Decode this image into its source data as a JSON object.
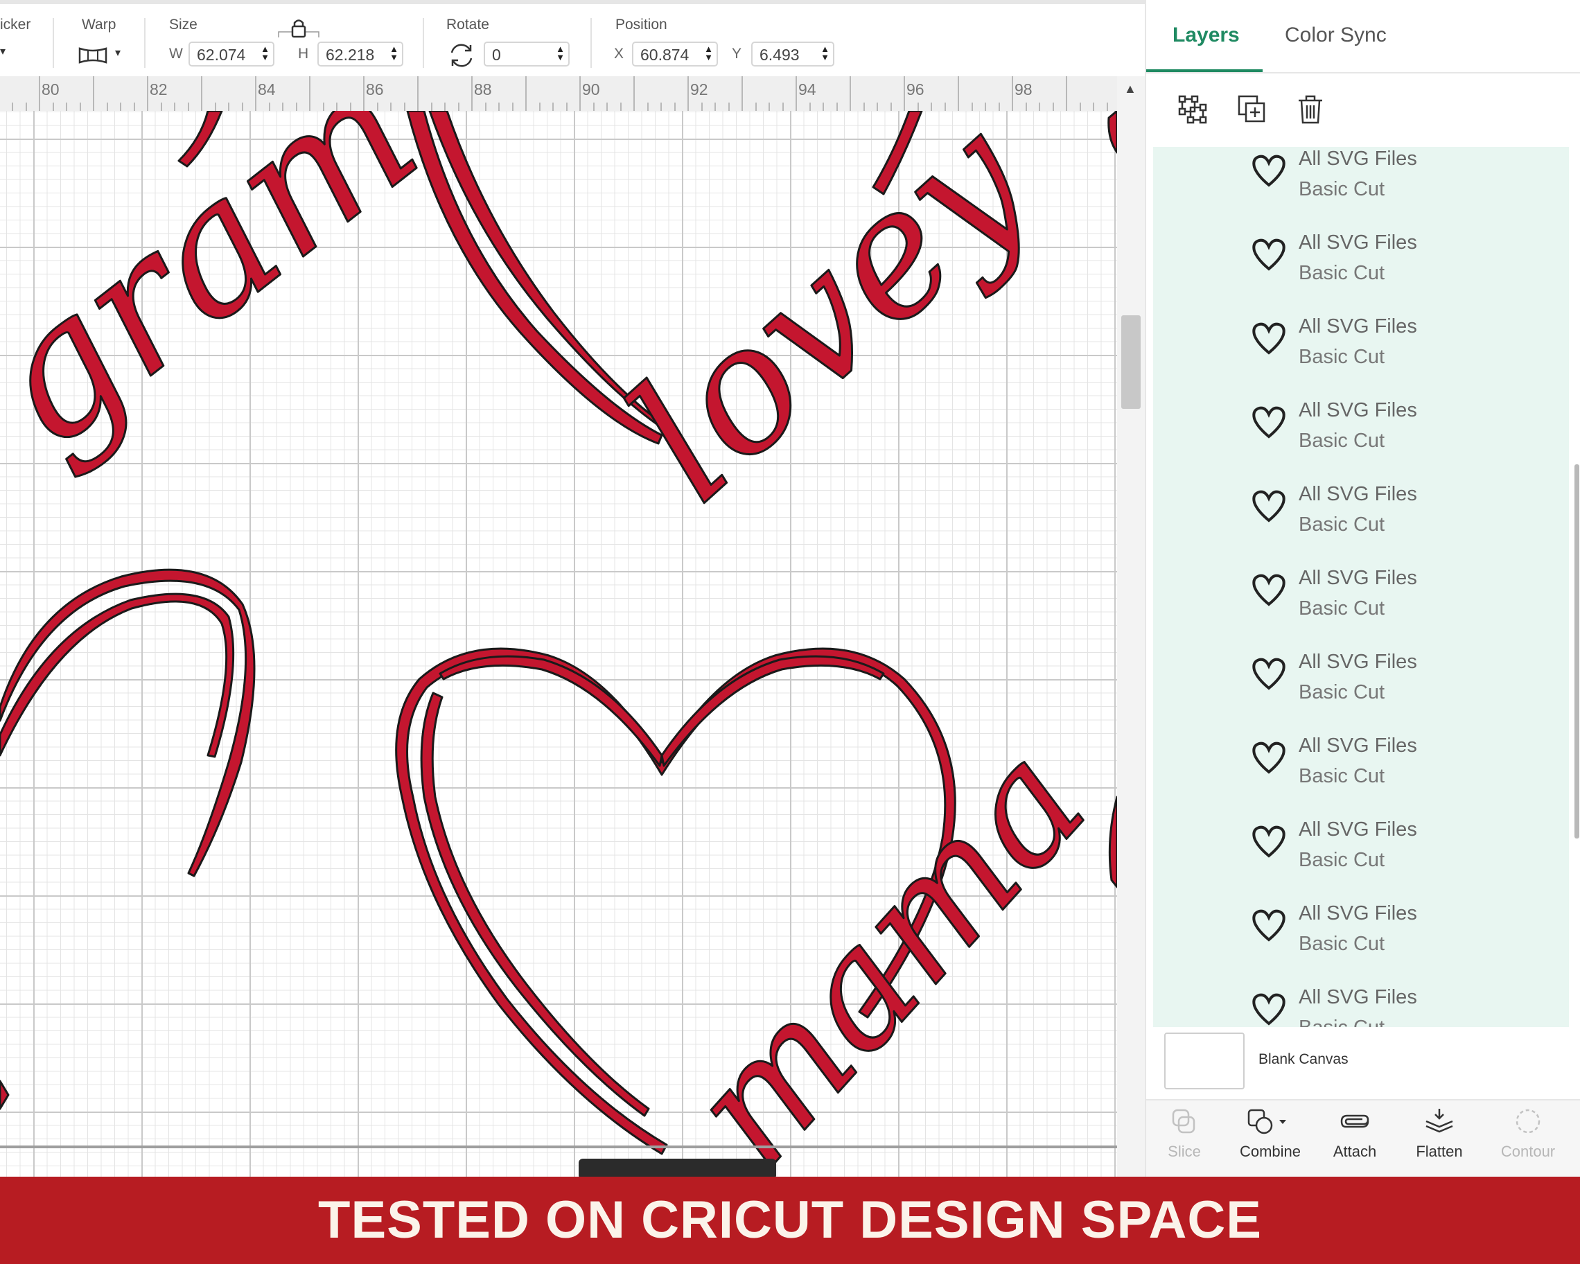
{
  "toolbar": {
    "sticker_label": "icker",
    "warp_label": "Warp",
    "size_label": "Size",
    "w_label": "W",
    "w_value": "62.074",
    "h_label": "H",
    "h_value": "62.218",
    "rotate_label": "Rotate",
    "rotate_value": "0",
    "position_label": "Position",
    "x_label": "X",
    "x_value": "60.874",
    "y_label": "Y",
    "y_value": "6.493"
  },
  "ruler": {
    "numbers": [
      "80",
      "82",
      "84",
      "86",
      "88",
      "90",
      "92",
      "94",
      "96",
      "98"
    ]
  },
  "canvas": {
    "words": [
      "gram",
      "lovey",
      "mama"
    ],
    "fill_color": "#c4162f",
    "stroke_color": "#1a1a1a"
  },
  "panel": {
    "tabs": [
      "Layers",
      "Color Sync"
    ],
    "active_tab": "Layers",
    "layers": [
      {
        "name": "All SVG Files",
        "op": "Basic Cut"
      },
      {
        "name": "All SVG Files",
        "op": "Basic Cut"
      },
      {
        "name": "All SVG Files",
        "op": "Basic Cut"
      },
      {
        "name": "All SVG Files",
        "op": "Basic Cut"
      },
      {
        "name": "All SVG Files",
        "op": "Basic Cut"
      },
      {
        "name": "All SVG Files",
        "op": "Basic Cut"
      },
      {
        "name": "All SVG Files",
        "op": "Basic Cut"
      },
      {
        "name": "All SVG Files",
        "op": "Basic Cut"
      },
      {
        "name": "All SVG Files",
        "op": "Basic Cut"
      },
      {
        "name": "All SVG Files",
        "op": "Basic Cut"
      },
      {
        "name": "All SVG Files",
        "op": "Basic Cut"
      }
    ],
    "layer_icon": "heart-icon",
    "blank_canvas_label": "Blank Canvas",
    "actions": [
      {
        "label": "Slice",
        "icon": "slice-icon",
        "enabled": false
      },
      {
        "label": "Combine",
        "icon": "combine-icon",
        "enabled": true
      },
      {
        "label": "Attach",
        "icon": "attach-icon",
        "enabled": true
      },
      {
        "label": "Flatten",
        "icon": "flatten-icon",
        "enabled": true
      },
      {
        "label": "Contour",
        "icon": "contour-icon",
        "enabled": false
      }
    ],
    "accent_color": "#1f8a62"
  },
  "banner": {
    "text": "TESTED ON CRICUT DESIGN SPACE",
    "color": "#b71c22"
  }
}
